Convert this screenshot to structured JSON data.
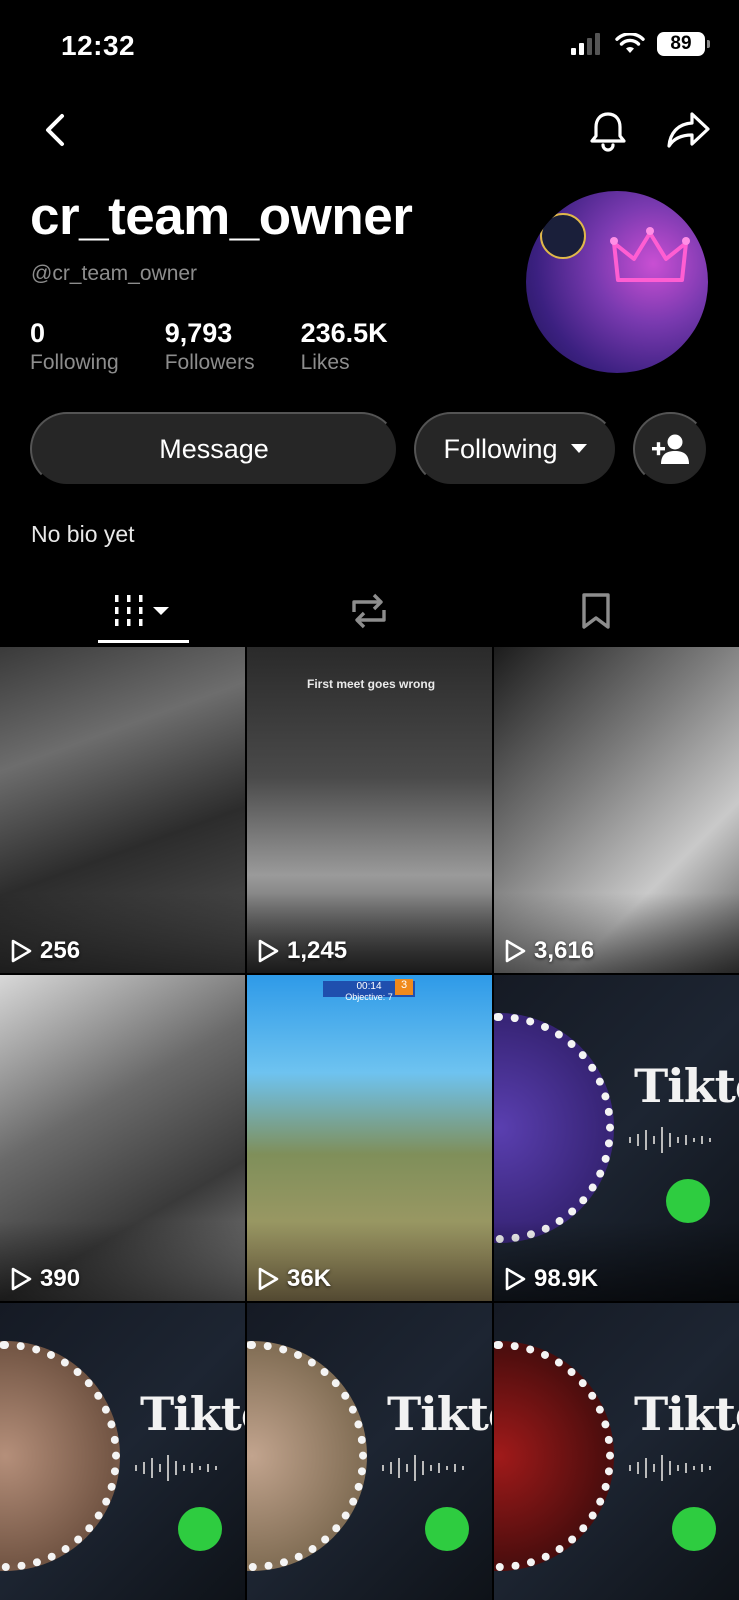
{
  "status_bar": {
    "time": "12:32",
    "battery": "89"
  },
  "profile": {
    "username": "cr_team_owner",
    "handle": "@cr_team_owner",
    "stats": [
      {
        "value": "0",
        "label": "Following"
      },
      {
        "value": "9,793",
        "label": "Followers"
      },
      {
        "value": "236.5K",
        "label": "Likes"
      }
    ],
    "bio": "No bio yet"
  },
  "actions": {
    "message_label": "Message",
    "following_label": "Following"
  },
  "tabs": [
    {
      "icon": "grid-icon",
      "active": true
    },
    {
      "icon": "repost-icon",
      "active": false
    },
    {
      "icon": "bookmark-icon",
      "active": false
    }
  ],
  "videos": [
    {
      "views": "256"
    },
    {
      "views": "1,245",
      "caption": "First meet goes wrong"
    },
    {
      "views": "3,616"
    },
    {
      "views": "390"
    },
    {
      "views": "36K",
      "hud_time": "00:14",
      "hud_objective": "Objective: 7",
      "hud_number": "3"
    },
    {
      "views": "98.9K",
      "brand": "Tiktok"
    },
    {
      "views": "",
      "brand": "Tiktok"
    },
    {
      "views": "",
      "brand": "Tiktok"
    },
    {
      "views": "",
      "brand": "Tiktok"
    }
  ],
  "colors": {
    "background": "#000000",
    "button": "#262626",
    "secondary_text": "#8d8d8d",
    "call_green": "#2ecc40"
  }
}
